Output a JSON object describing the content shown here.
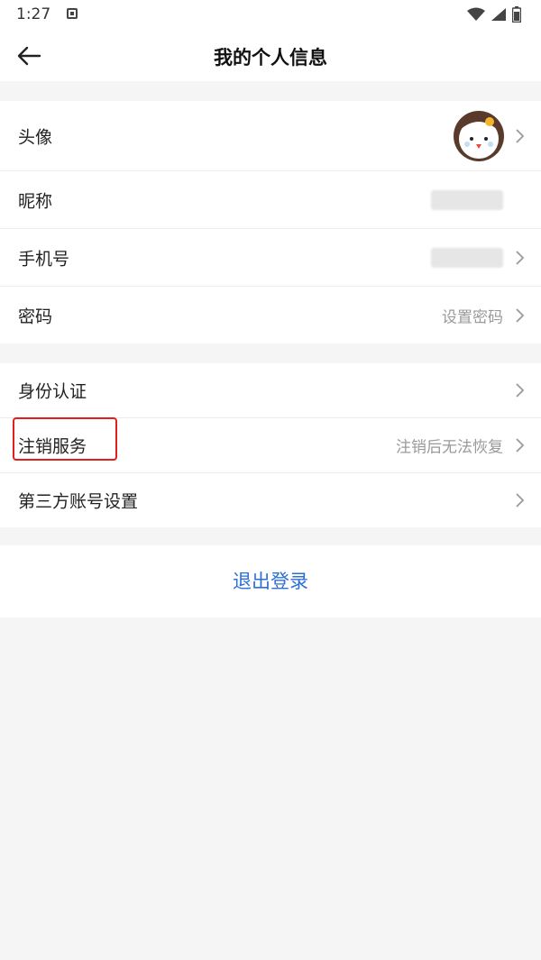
{
  "status_bar": {
    "time": "1:27"
  },
  "header": {
    "title": "我的个人信息"
  },
  "profile_group": {
    "avatar_label": "头像",
    "nickname_label": "昵称",
    "phone_label": "手机号",
    "password_label": "密码",
    "password_value": "设置密码"
  },
  "account_group": {
    "identity_label": "身份认证",
    "cancel_label": "注销服务",
    "cancel_value": "注销后无法恢复",
    "third_party_label": "第三方账号设置"
  },
  "logout": {
    "label": "退出登录"
  },
  "colors": {
    "accent": "#2e6fd6",
    "highlight": "#e02020",
    "background": "#f5f5f5"
  }
}
